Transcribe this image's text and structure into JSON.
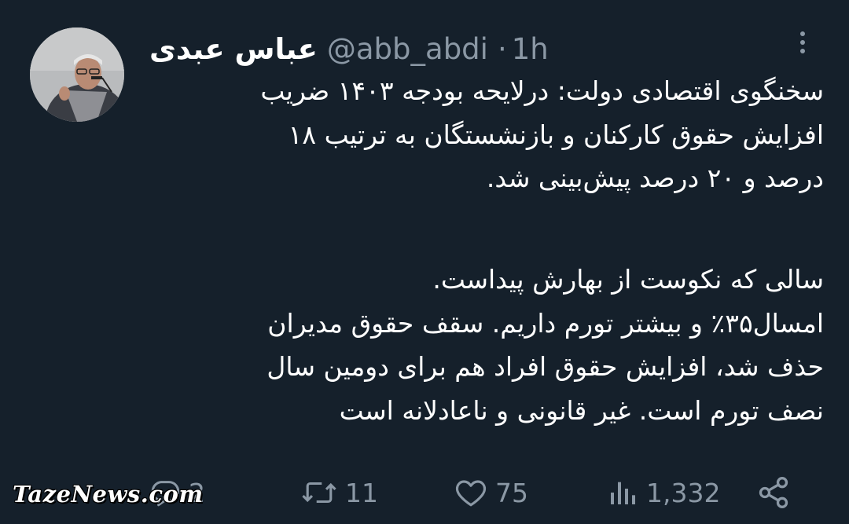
{
  "tweet": {
    "author_name": "عباس عبدی",
    "handle": "@abb_abdi",
    "separator": "·",
    "time": "1h",
    "text_paragraph_1": [
      "سخنگوی اقتصادی دولت: درلایحه بودجه ۱۴۰۳ ضریب",
      "افزایش حقوق کارکنان و بازنشستگان به ترتیب ۱۸",
      "درصد و ۲۰ درصد پیش‌بینی شد."
    ],
    "text_paragraph_2": [
      "سالی که نکوست از بهارش پیداست.",
      "امسال۳۵٪ و بیشتر تورم داریم. سقف حقوق مدیران",
      "حذف شد، افزایش حقوق افراد هم برای دومین سال",
      "نصف تورم است. غیر قانونی و ناعادلانه است"
    ]
  },
  "actions": {
    "replies": "2",
    "retweets": "11",
    "likes": "75",
    "views": "1,332"
  },
  "watermark": "TazeNews.com",
  "icons": {
    "more": "more-dots-icon",
    "reply": "reply-icon",
    "retweet": "retweet-icon",
    "like": "heart-icon",
    "views": "views-icon",
    "share": "share-icon"
  },
  "colors": {
    "background": "#15202b",
    "text": "#ffffff",
    "muted": "#8b98a5"
  }
}
